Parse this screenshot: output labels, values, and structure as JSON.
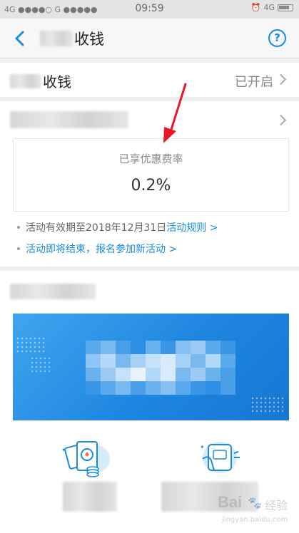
{
  "status_bar": {
    "left": "4G ●●●●○ G ●●●●●",
    "time": "09:59",
    "right": "4G"
  },
  "nav": {
    "title_suffix": "收钱",
    "help_label": "?"
  },
  "collection": {
    "label_suffix": "收钱",
    "status": "已开启"
  },
  "discount": {
    "rate_label": "已享优惠费率",
    "rate_value": "0.2%",
    "notice_prefix": "活动有效期至2018年12月31日",
    "rules_link": "活动规则 >",
    "new_activity_link": "活动即将结束，报名参加新活动 >"
  },
  "colors": {
    "accent": "#1a8ce0",
    "banner": "#1e86e0",
    "annotation_arrow": "#e8192c"
  },
  "watermark": {
    "brand": "Bai",
    "brand_tail": "经验",
    "url": "jingyan.baidu.com"
  }
}
